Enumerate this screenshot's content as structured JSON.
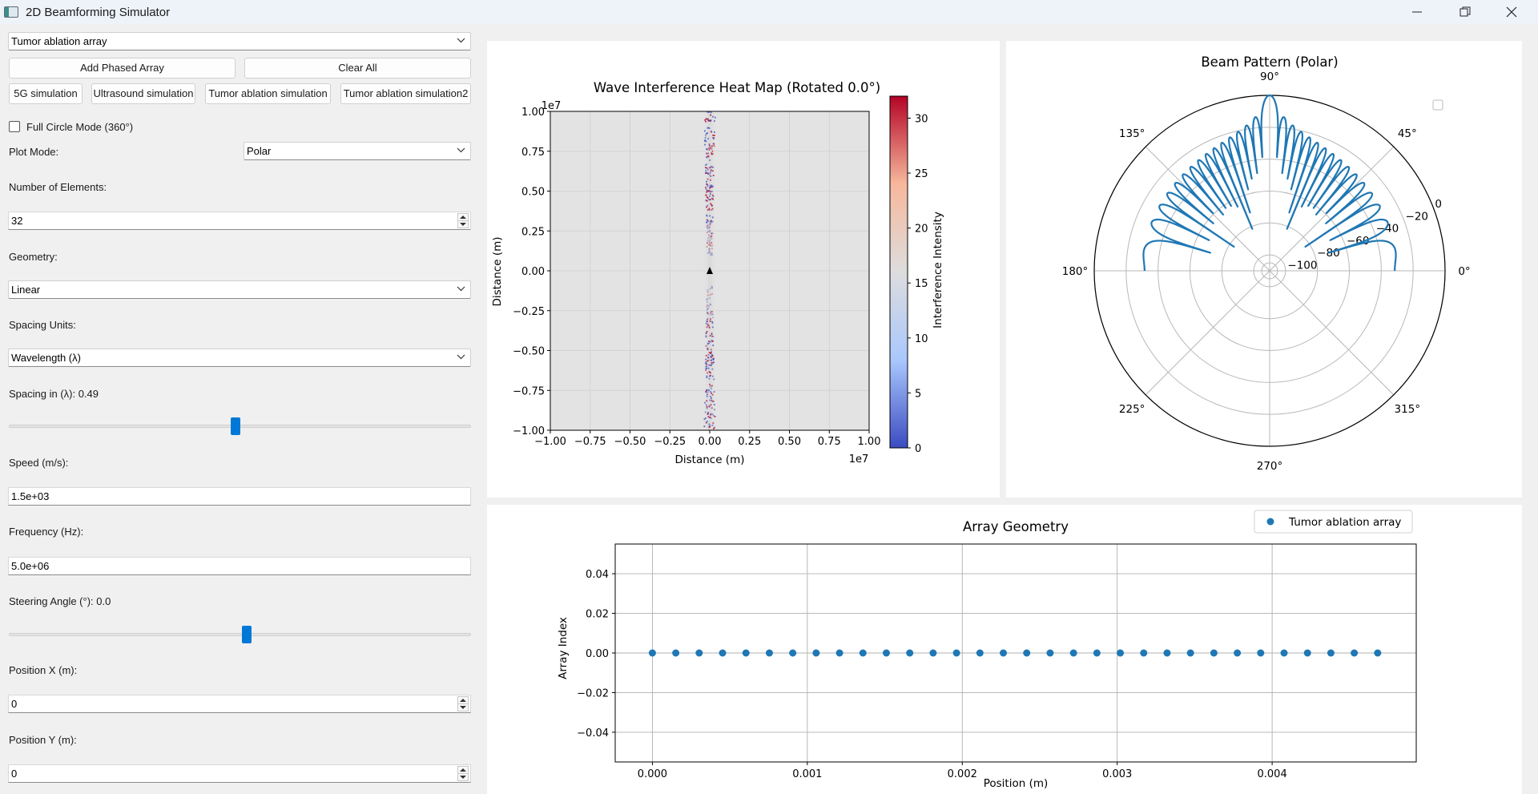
{
  "window": {
    "title": "2D Beamforming Simulator"
  },
  "controls": {
    "array_select": "Tumor ablation array",
    "add_button": "Add Phased Array",
    "clear_button": "Clear All",
    "preset_5g": "5G simulation",
    "preset_ultrasound": "Ultrasound simulation",
    "preset_tumor": "Tumor ablation simulation",
    "preset_tumor2": "Tumor ablation simulation2",
    "full_circle_label": "Full Circle Mode (360°)",
    "full_circle_checked": false,
    "plot_mode_label": "Plot Mode:",
    "plot_mode_value": "Polar",
    "num_elements_label": "Number of Elements:",
    "num_elements_value": "32",
    "geometry_label": "Geometry:",
    "geometry_value": "Linear",
    "spacing_units_label": "Spacing Units:",
    "spacing_units_value": "Wavelength (λ)",
    "spacing_label": "Spacing in (λ): 0.49",
    "spacing_slider_fraction": 0.49,
    "speed_label": "Speed (m/s):",
    "speed_value": "1.5e+03",
    "frequency_label": "Frequency (Hz):",
    "frequency_value": "5.0e+06",
    "steering_label": "Steering Angle (°): 0.0",
    "steering_slider_fraction": 0.5,
    "pos_x_label": "Position X (m):",
    "pos_x_value": "0",
    "pos_y_label": "Position Y (m):",
    "pos_y_value": "0"
  },
  "chart_data": [
    {
      "type": "heatmap",
      "title": "Wave Interference Heat Map (Rotated 0.0°)",
      "xlabel": "Distance (m)",
      "ylabel": "Distance (m)",
      "x_offset_label": "1e7",
      "y_offset_label": "1e7",
      "xlim": [
        -1.0,
        1.0
      ],
      "ylim": [
        -1.0,
        1.0
      ],
      "x_ticks": [
        "−1.00",
        "−0.75",
        "−0.50",
        "−0.25",
        "0.00",
        "0.25",
        "0.50",
        "0.75",
        "1.00"
      ],
      "y_ticks": [
        "1.00",
        "0.75",
        "0.50",
        "0.25",
        "0.00",
        "−0.25",
        "−0.50",
        "−0.75",
        "−1.00"
      ],
      "colorbar_label": "Interference Intensity",
      "colorbar_range": [
        0,
        32
      ],
      "colorbar_ticks": [
        "30",
        "25",
        "20",
        "15",
        "10",
        "5",
        "0"
      ],
      "colormap": [
        "#3b4cc0",
        "#aac7fd",
        "#dddddd",
        "#f7b89c",
        "#b40426"
      ],
      "grid": true,
      "marker": "array position at origin"
    },
    {
      "type": "line",
      "title": "Beam Pattern (Polar)",
      "angle_labels": [
        "0°",
        "45°",
        "90°",
        "135°",
        "180°",
        "225°",
        "270°",
        "315°"
      ],
      "radial_ticks": [
        "0",
        "−20",
        "−40",
        "−60",
        "−80",
        "−100"
      ],
      "r_range_db": [
        -110,
        0
      ],
      "main_lobe_deg": 90,
      "sidelobe_count_per_side": 15,
      "color": "#1f77b4"
    },
    {
      "type": "scatter",
      "title": "Array Geometry",
      "xlabel": "Position (m)",
      "ylabel": "Array Index",
      "xlim": [
        -0.00024,
        0.00493
      ],
      "ylim": [
        -0.055,
        0.055
      ],
      "x_ticks": [
        "0.000",
        "0.001",
        "0.002",
        "0.003",
        "0.004"
      ],
      "y_ticks": [
        "0.04",
        "0.02",
        "0.00",
        "−0.02",
        "−0.04"
      ],
      "series": [
        {
          "name": "Tumor ablation array",
          "color": "#1f77b4",
          "x": [
            0.0,
            0.000151,
            0.000302,
            0.000453,
            0.000604,
            0.000755,
            0.000906,
            0.001057,
            0.001208,
            0.001359,
            0.00151,
            0.001661,
            0.001812,
            0.001963,
            0.002114,
            0.002265,
            0.002416,
            0.002567,
            0.002718,
            0.002869,
            0.00302,
            0.003171,
            0.003322,
            0.003473,
            0.003624,
            0.003775,
            0.003926,
            0.004077,
            0.004228,
            0.004379,
            0.00453,
            0.004681
          ],
          "y": [
            0,
            0,
            0,
            0,
            0,
            0,
            0,
            0,
            0,
            0,
            0,
            0,
            0,
            0,
            0,
            0,
            0,
            0,
            0,
            0,
            0,
            0,
            0,
            0,
            0,
            0,
            0,
            0,
            0,
            0,
            0,
            0
          ]
        }
      ],
      "legend": "top-right",
      "grid": true
    }
  ]
}
